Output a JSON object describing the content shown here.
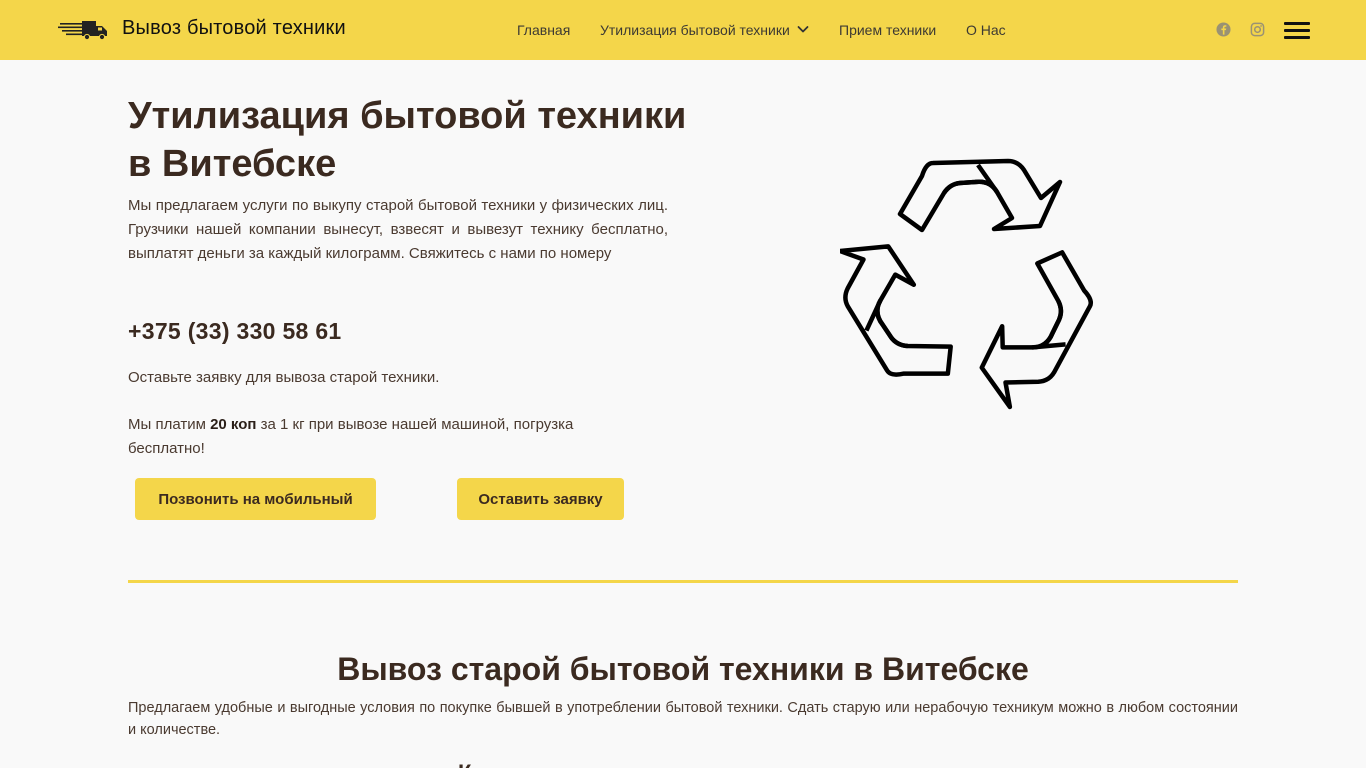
{
  "header": {
    "brand_name": "Вывоз бытовой техники",
    "nav": [
      {
        "label": "Главная"
      },
      {
        "label": "Утилизация бытовой техники",
        "has_dropdown": true
      },
      {
        "label": "Прием техники"
      },
      {
        "label": "О Нас"
      }
    ]
  },
  "hero": {
    "title": "Утилизация бытовой техники в Витебске",
    "description": "Мы предлагаем услуги по выкупу старой бытовой техники у физических лиц. Грузчики нашей компании вынесут, взвесят и вывезут технику бесплатно, выплатят деньги за каждый килограмм. Свяжитесь с нами по номеру",
    "phone": "+375 (33) 330 58 61",
    "note1": "Оставьте заявку для вывоза старой техники.",
    "note2_pre": "Мы платим ",
    "note2_bold": "20 коп",
    "note2_post": " за 1 кг при вывозе нашей машиной, погрузка бесплатно!",
    "btn_call": "Позвонить на мобильный",
    "btn_order": "Оставить заявку"
  },
  "section": {
    "title": "Вывоз старой бытовой техники в Витебске",
    "description": "Предлагаем удобные и выгодные условия по покупке бывшей в употреблении бытовой техники. Сдать старую или нерабочую техникум можно в любом состоянии и количестве.",
    "cut_heading": "К"
  },
  "colors": {
    "accent": "#f4d64a",
    "text": "#3b2a20"
  },
  "icons": [
    "truck-logo-icon",
    "chevron-down-icon",
    "facebook-icon",
    "instagram-icon",
    "hamburger-menu-icon",
    "recycle-icon"
  ]
}
